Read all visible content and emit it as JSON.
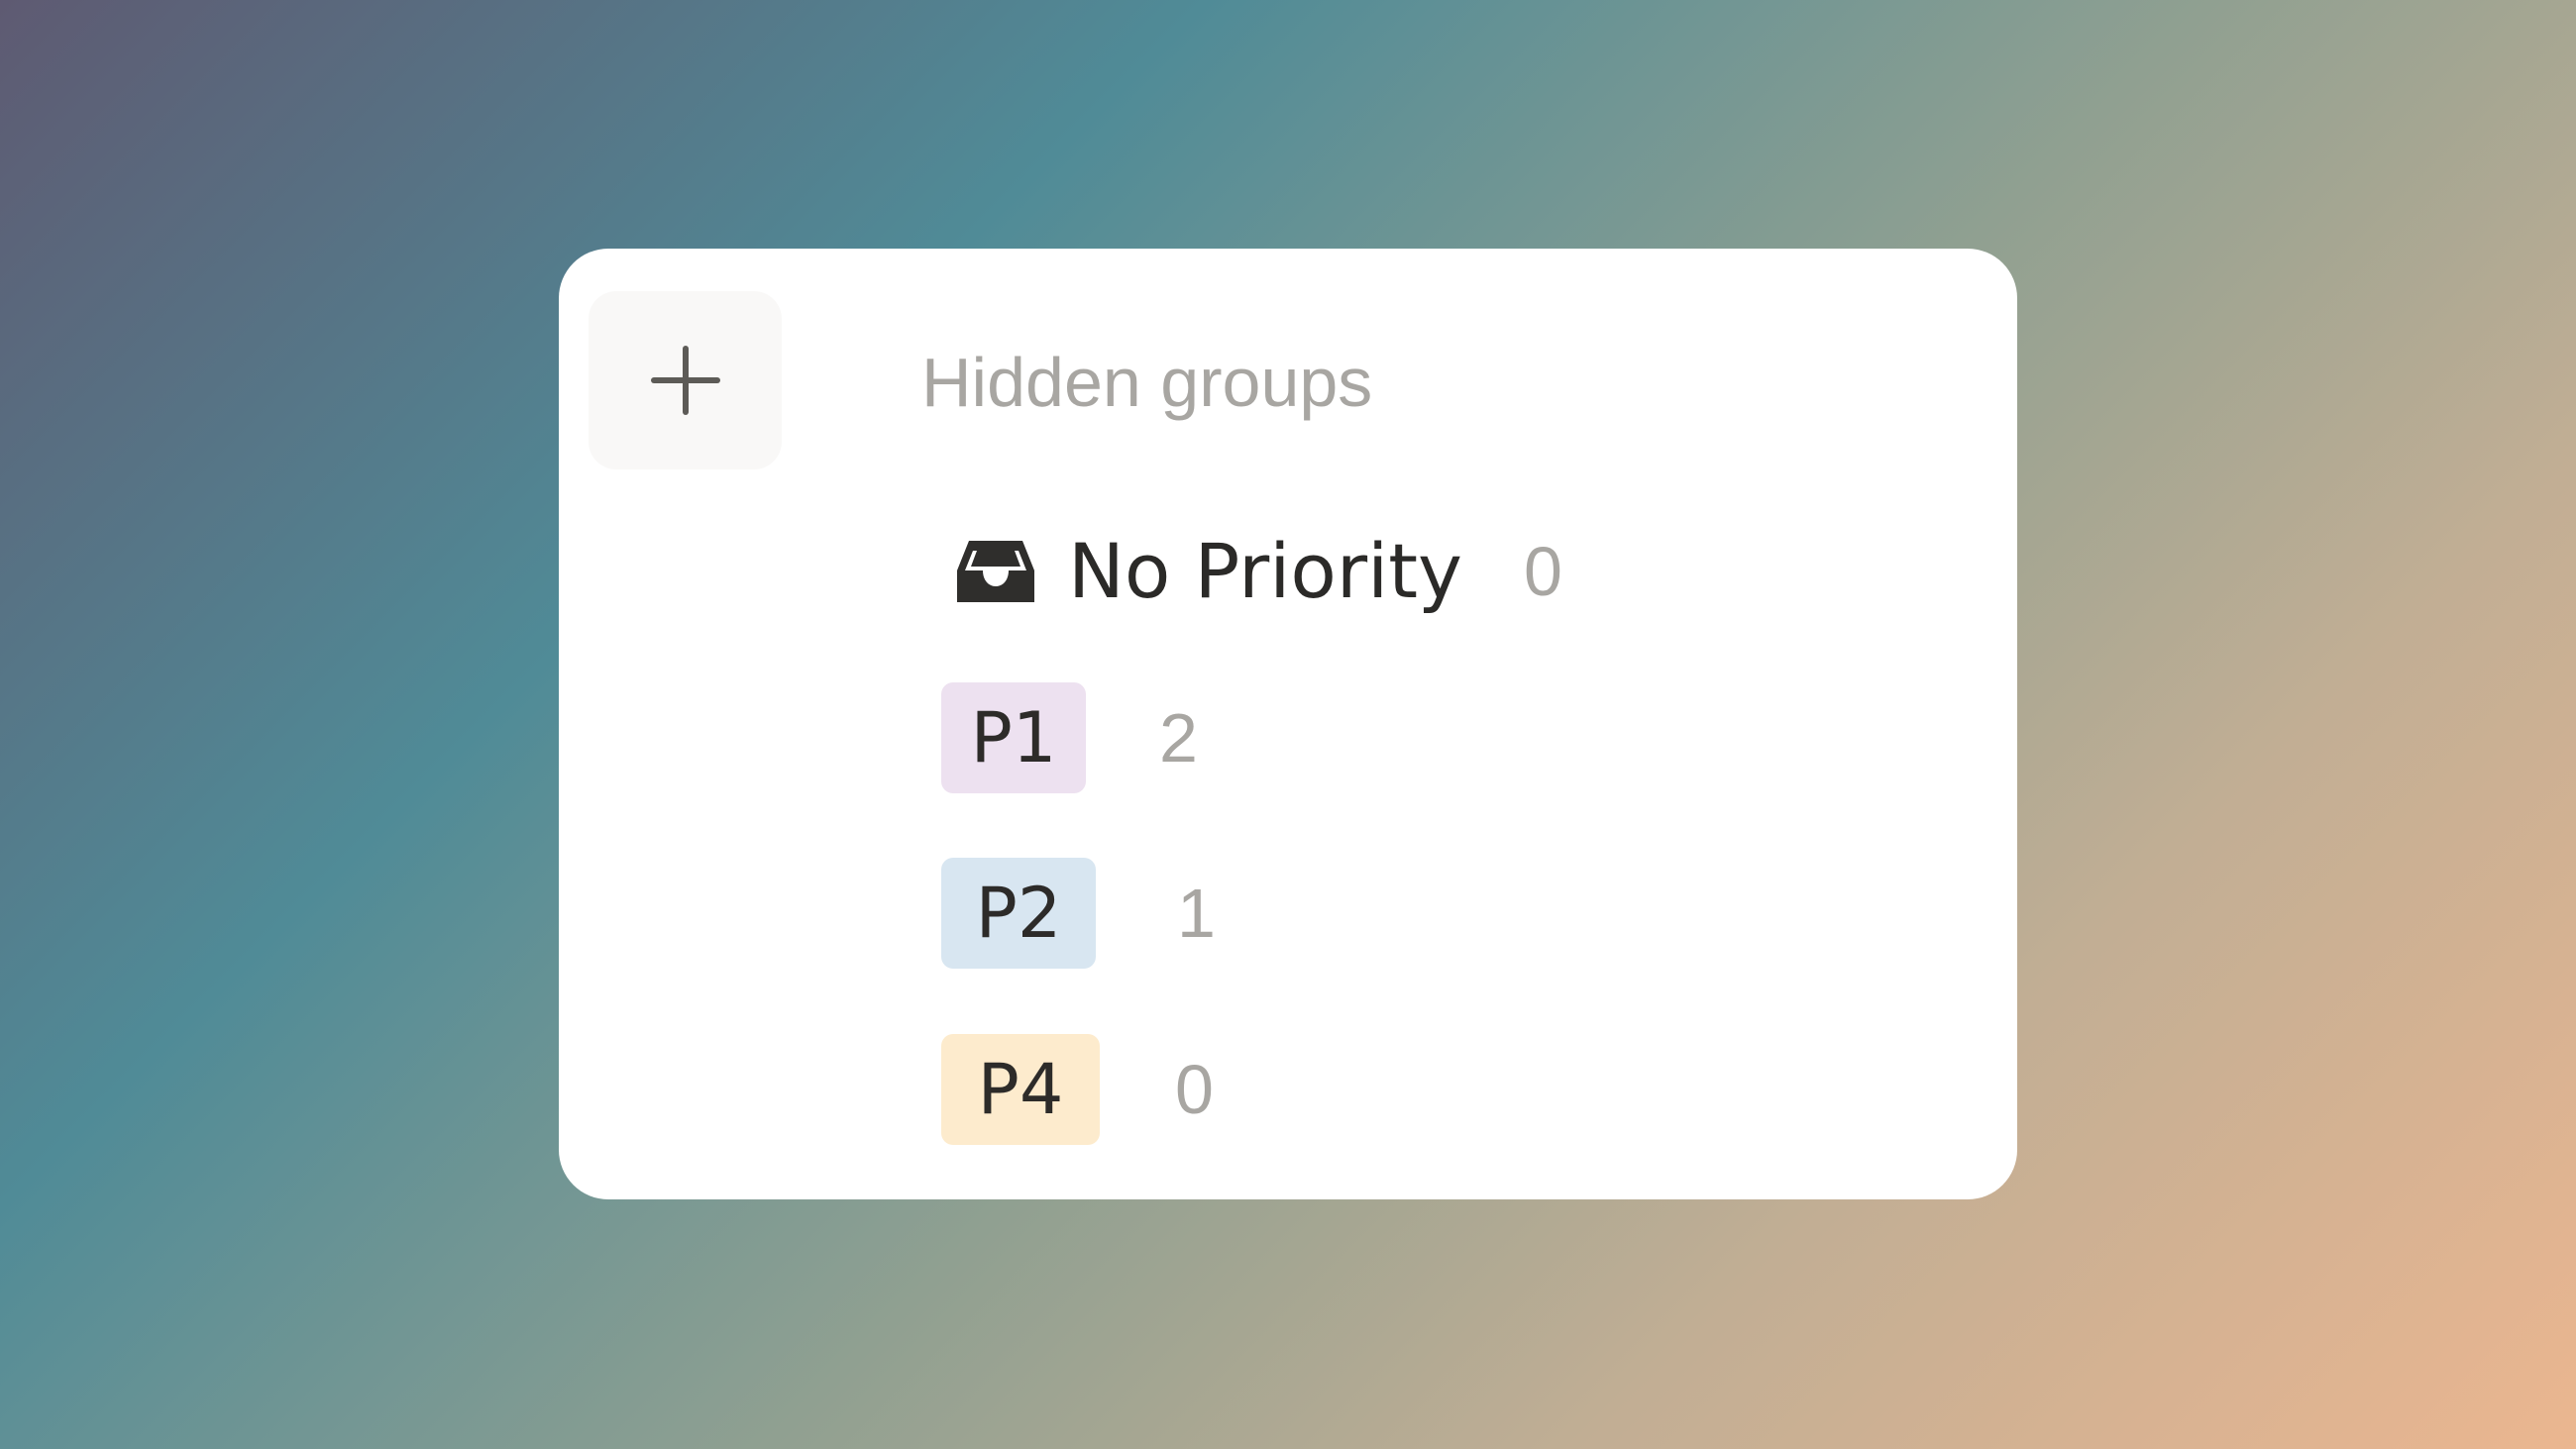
{
  "panel": {
    "add_button_icon": "plus-icon",
    "section_title": "Hidden groups"
  },
  "groups": [
    {
      "icon": "inbox-icon",
      "label": "No Priority",
      "count": "0"
    },
    {
      "label": "P1",
      "count": "2",
      "badge_color": "#ede1f0"
    },
    {
      "label": "P2",
      "count": "1",
      "badge_color": "#d8e6f1"
    },
    {
      "label": "P4",
      "count": "0",
      "badge_color": "#fdebcd"
    }
  ],
  "colors": {
    "card_background": "#ffffff",
    "muted_text": "#a8a6a2",
    "primary_text": "#2b2a28"
  }
}
